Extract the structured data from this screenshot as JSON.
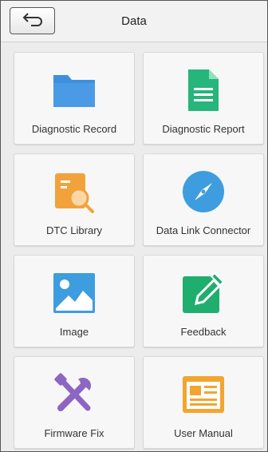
{
  "header": {
    "title": "Data",
    "back_icon": "back-arrow-icon"
  },
  "colors": {
    "blue": "#3d8fe0",
    "green": "#26b57a",
    "orange": "#f2a23a",
    "purple": "#8d65c2",
    "sky": "#3d9ddf",
    "emerald": "#1fae6e",
    "amber": "#f2a52f"
  },
  "tiles": [
    {
      "label": "Diagnostic Record",
      "icon": "folder-icon"
    },
    {
      "label": "Diagnostic Report",
      "icon": "document-icon"
    },
    {
      "label": "DTC Library",
      "icon": "search-document-icon"
    },
    {
      "label": "Data Link Connector",
      "icon": "compass-icon"
    },
    {
      "label": "Image",
      "icon": "image-icon"
    },
    {
      "label": "Feedback",
      "icon": "edit-icon"
    },
    {
      "label": "Firmware Fix",
      "icon": "tools-icon"
    },
    {
      "label": "User Manual",
      "icon": "manual-icon"
    }
  ]
}
